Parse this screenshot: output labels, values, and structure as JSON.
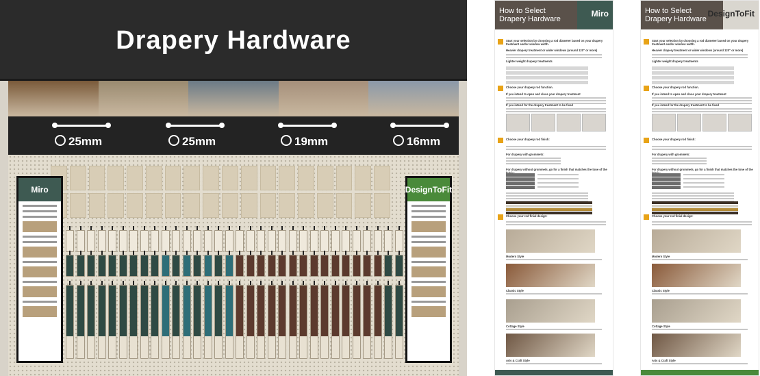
{
  "display": {
    "title": "Drapery Hardware",
    "rod_sizes": [
      "25mm",
      "25mm",
      "19mm",
      "16mm"
    ],
    "photo_colors": [
      "#7a5a3a",
      "#9a8a70",
      "#6b7a86",
      "#a58f7a",
      "#8a98a8"
    ],
    "left_sign": {
      "logo": "Miro",
      "color": "#3e5a52"
    },
    "right_sign": {
      "logo": "DesignToFit",
      "color": "#4a8a3a"
    }
  },
  "brochures": [
    {
      "title_line1": "How to Select",
      "title_line2": "Drapery Hardware",
      "logo": "Miro",
      "header_color": "#5a514a",
      "logo_bg": "#3e5a52",
      "footer_color": "#3e5a52"
    },
    {
      "title_line1": "How to Select",
      "title_line2": "Drapery Hardware",
      "logo": "DesignToFit",
      "header_color": "#5a514a",
      "logo_bg": "#d9d6cf",
      "footer_color": "#4a8a3a"
    }
  ],
  "steps": [
    {
      "num": "1",
      "heading": "Start your selection by choosing a rod diameter based on your drapery treatment and/or window width.",
      "sub1": "Heavier drapery treatment or wider windows (around 120\" or more)",
      "sub2": "Lighter weight drapery treatments"
    },
    {
      "num": "2",
      "heading": "Choose your drapery rod function.",
      "sub1": "If you intend to open and close your drapery treatment",
      "sub2": "If you intend for the drapery treatment to be fixed"
    },
    {
      "num": "3",
      "heading": "Choose your drapery rod finish:",
      "sub1": "For drapery with grommets:",
      "sub2": "For drapery without grommets, go for a finish that matches the tone of the fabric:"
    },
    {
      "num": "4",
      "heading": "Choose your rod finial design:",
      "styles": [
        "Modern Style",
        "Classic Style",
        "Cottage Style",
        "Arts & Craft Style"
      ]
    }
  ]
}
